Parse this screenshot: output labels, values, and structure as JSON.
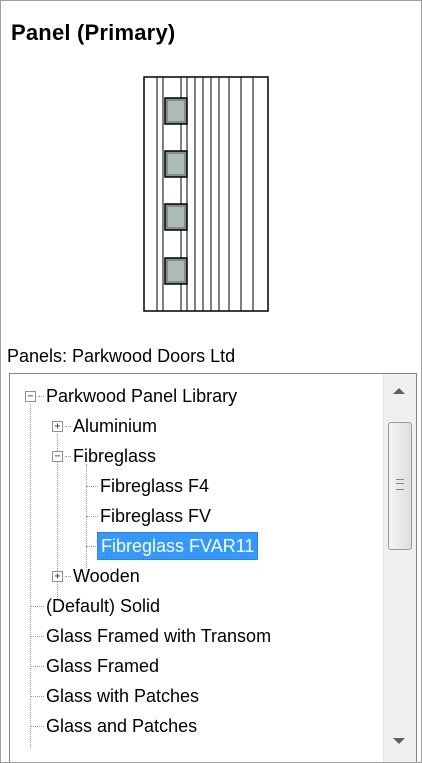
{
  "panel": {
    "title": "Panel (Primary)"
  },
  "library": {
    "label": "Panels: Parkwood Doors Ltd"
  },
  "tree": {
    "root": {
      "label": "Parkwood Panel Library",
      "expander": "−"
    },
    "aluminium": {
      "label": "Aluminium",
      "expander": "+"
    },
    "fibreglass": {
      "label": "Fibreglass",
      "expander": "−"
    },
    "f4": {
      "label": "Fibreglass F4"
    },
    "fv": {
      "label": "Fibreglass FV"
    },
    "fvar11": {
      "label": "Fibreglass FVAR11",
      "selected": true
    },
    "wooden": {
      "label": "Wooden",
      "expander": "+"
    },
    "default_solid": {
      "label": "(Default) Solid"
    },
    "glass_transom": {
      "label": "Glass Framed with Transom"
    },
    "glass_framed": {
      "label": "Glass Framed"
    },
    "glass_patches": {
      "label": "Glass with Patches"
    },
    "cut_off": {
      "label": "Glass and Patches"
    }
  },
  "colors": {
    "selection": "#3399ff",
    "border": "#828790"
  }
}
